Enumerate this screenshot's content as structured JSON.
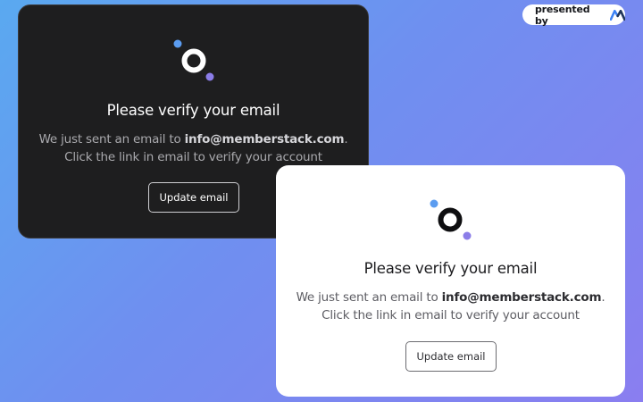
{
  "badge": {
    "text": "presented by",
    "logo_icon": "memberstack-logo-icon"
  },
  "dark_card": {
    "logo_icon": "memberstack-dot-logo-icon",
    "title": "Please verify your email",
    "line1_prefix": "We just sent an email to ",
    "email": "info@memberstack.com",
    "line1_suffix": ".",
    "line2": "Click the link in email to verify your account",
    "button_label": "Update email"
  },
  "light_card": {
    "logo_icon": "memberstack-dot-logo-icon",
    "title": "Please verify your email",
    "line1_prefix": "We just sent an email to ",
    "email": "info@memberstack.com",
    "line1_suffix": ".",
    "line2": "Click the link in email to verify your account",
    "button_label": "Update email"
  },
  "colors": {
    "background_start": "#5aa9f0",
    "background_end": "#8a7ef0",
    "dark_card_bg": "#1e1e1f",
    "light_card_bg": "#ffffff",
    "dot_blue": "#5b9cf0",
    "dot_purple": "#8b7de8"
  }
}
